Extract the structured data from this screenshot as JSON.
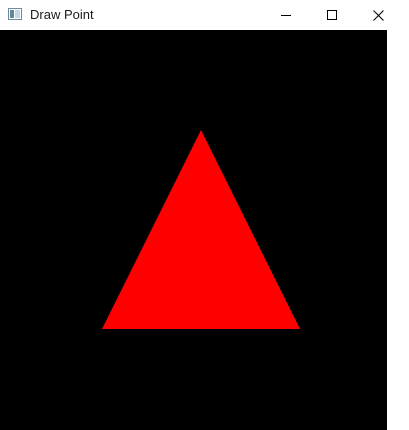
{
  "window": {
    "title": "Draw Point",
    "background_color": "#000000"
  },
  "titlebar": {
    "icons": {
      "app": "application-icon",
      "minimize": "minimize-icon",
      "maximize": "maximize-icon",
      "close": "close-icon"
    }
  },
  "scene": {
    "shape": "triangle",
    "fill_color": "#ff0000"
  }
}
